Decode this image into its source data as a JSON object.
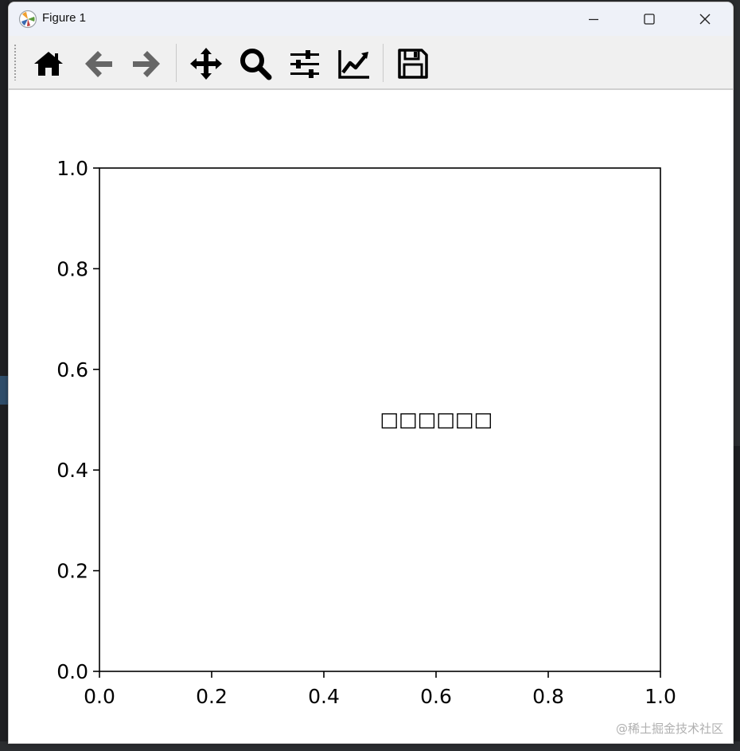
{
  "window": {
    "title": "Figure 1",
    "controls": [
      "minimize",
      "maximize",
      "close"
    ]
  },
  "toolbar": {
    "buttons": [
      {
        "name": "home",
        "icon": "home-icon"
      },
      {
        "name": "back",
        "icon": "arrow-left-icon"
      },
      {
        "name": "forward",
        "icon": "arrow-right-icon"
      },
      {
        "name": "pan",
        "icon": "move-arrows-icon"
      },
      {
        "name": "zoom",
        "icon": "magnifier-icon"
      },
      {
        "name": "subplots",
        "icon": "sliders-icon"
      },
      {
        "name": "edit-axes",
        "icon": "line-chart-icon"
      },
      {
        "name": "save",
        "icon": "floppy-disk-icon"
      }
    ]
  },
  "chart_data": {
    "type": "scatter",
    "title": "",
    "xlabel": "",
    "ylabel": "",
    "xlim": [
      0.0,
      1.0
    ],
    "ylim": [
      0.0,
      1.0
    ],
    "x_ticks": [
      "0.0",
      "0.2",
      "0.4",
      "0.6",
      "0.8",
      "1.0"
    ],
    "y_ticks": [
      "0.0",
      "0.2",
      "0.4",
      "0.6",
      "0.8",
      "1.0"
    ],
    "grid": false,
    "series": [],
    "annotations": [
      {
        "text": "□□□□□□",
        "x": 0.5,
        "y": 0.5
      }
    ]
  },
  "watermark": "@稀土掘金技术社区",
  "colors": {
    "titlebar": "#eef1f8",
    "toolbar": "#f0f0f0",
    "disabled_icon": "#666666",
    "icon": "#000000"
  }
}
